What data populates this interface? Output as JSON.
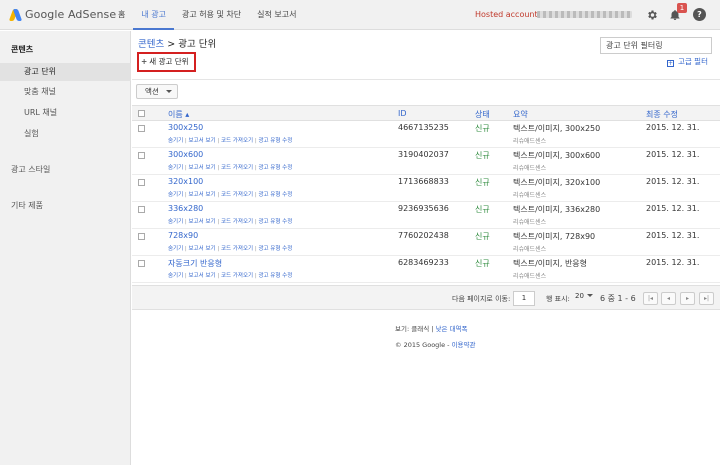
{
  "app": {
    "logo_text": "Google AdSense"
  },
  "nav": {
    "tabs": [
      "홈",
      "내 광고",
      "광고 허용 및 차단",
      "실적 보고서"
    ],
    "active": "내 광고"
  },
  "account": {
    "label": "Hosted account",
    "notification_count": "1"
  },
  "sidebar": {
    "items": [
      {
        "label": "콘텐츠",
        "kind": "header"
      },
      {
        "label": "광고 단위",
        "kind": "sub",
        "active": true
      },
      {
        "label": "맞춤 채널",
        "kind": "sub"
      },
      {
        "label": "URL 채널",
        "kind": "sub"
      },
      {
        "label": "실험",
        "kind": "sub"
      },
      {
        "label": "광고 스타일",
        "kind": "top"
      },
      {
        "label": "기타 제품",
        "kind": "top"
      }
    ]
  },
  "main": {
    "breadcrumb": {
      "parent": "콘텐츠",
      "separator": " > ",
      "current": "광고 단위"
    },
    "filter_value": "광고 단위 필터링",
    "new_button": "새 광고 단위",
    "advanced_filter": "고급 필터",
    "action_button": "액션",
    "columns": {
      "name": "이름 ▴",
      "id": "ID",
      "status": "상태",
      "summary": "요약",
      "modified": "최종 수정"
    },
    "row_links": [
      "숨기기",
      "보고서 보기",
      "코드 가져오기",
      "광고 유형 수정"
    ],
    "row_links_separator": " | ",
    "rows": [
      {
        "name": "300x250",
        "id": "4667135235",
        "status": "신규",
        "summary": "텍스트/이미지, 300x250",
        "summary_sub": "리슈애드센스",
        "modified": "2015. 12. 31."
      },
      {
        "name": "300x600",
        "id": "3190402037",
        "status": "신규",
        "summary": "텍스트/이미지, 300x600",
        "summary_sub": "리슈애드센스",
        "modified": "2015. 12. 31."
      },
      {
        "name": "320x100",
        "id": "1713668833",
        "status": "신규",
        "summary": "텍스트/이미지, 320x100",
        "summary_sub": "리슈애드센스",
        "modified": "2015. 12. 31."
      },
      {
        "name": "336x280",
        "id": "9236935636",
        "status": "신규",
        "summary": "텍스트/이미지, 336x280",
        "summary_sub": "리슈애드센스",
        "modified": "2015. 12. 31."
      },
      {
        "name": "728x90",
        "id": "7760202438",
        "status": "신규",
        "summary": "텍스트/이미지, 728x90",
        "summary_sub": "리슈애드센스",
        "modified": "2015. 12. 31."
      },
      {
        "name": "자동크기 반응형",
        "id": "6283469233",
        "status": "신규",
        "summary": "텍스트/이미지, 반응형",
        "summary_sub": "리슈애드센스",
        "modified": "2015. 12. 31."
      }
    ],
    "pager": {
      "goto_label": "다음 페이지로 이동:",
      "page_value": "1",
      "rows_label": "행 표시:",
      "rows_value": "20",
      "range": "6 중 1 - 6"
    },
    "footer": {
      "view_label": "보기:",
      "classic": "클래식",
      "separator": " | ",
      "low_contrast": "낮은 대역폭",
      "copyright": "© 2015 Google - ",
      "terms": "이용약관"
    }
  }
}
